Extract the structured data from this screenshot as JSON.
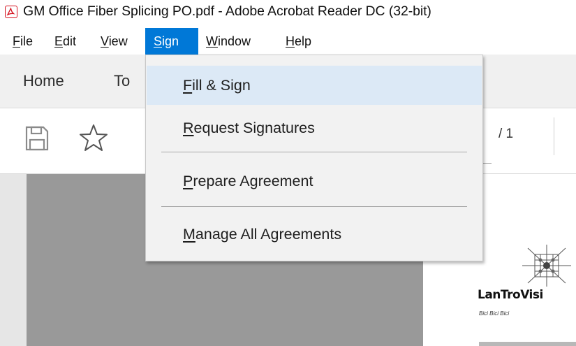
{
  "window": {
    "title": "GM Office  Fiber Splicing PO.pdf - Adobe Acrobat Reader DC (32-bit)",
    "icon": "acrobat-icon",
    "accent_color": "#d4111e"
  },
  "menubar": {
    "items": [
      {
        "mnemonic": "F",
        "rest": "ile"
      },
      {
        "mnemonic": "E",
        "rest": "dit"
      },
      {
        "mnemonic": "V",
        "rest": "iew"
      },
      {
        "mnemonic": "S",
        "rest": "ign"
      },
      {
        "mnemonic": "W",
        "rest": "indow"
      },
      {
        "mnemonic": "H",
        "rest": "elp"
      }
    ],
    "active_color": "#0078d7"
  },
  "tabs": [
    {
      "label": "Home"
    },
    {
      "label": "To"
    }
  ],
  "toolbar": {
    "icons": [
      "save-icon",
      "bookmark-star-icon"
    ],
    "page_total": "/ 1"
  },
  "sign_menu": {
    "items": [
      {
        "mnemonic": "F",
        "rest": "ill & Sign",
        "highlighted": true
      },
      {
        "mnemonic": "R",
        "rest": "equest Signatures",
        "highlighted": false
      },
      {
        "mnemonic": "P",
        "rest": "repare Agreement",
        "highlighted": false
      },
      {
        "mnemonic": "M",
        "rest": "anage All Agreements",
        "highlighted": false
      }
    ],
    "highlight_color": "#dce9f6"
  },
  "document": {
    "logo_text": "LanTroVisi",
    "logo_sub": "Bici Bici Bici",
    "page_color_left": "#999999"
  }
}
